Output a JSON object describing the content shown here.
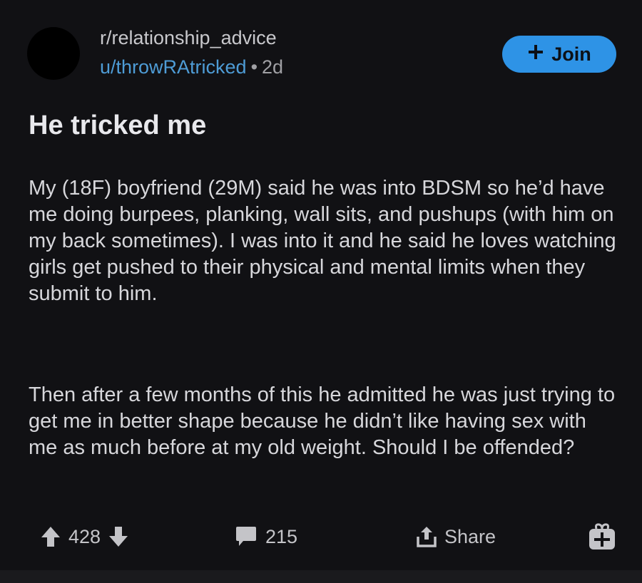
{
  "post": {
    "subreddit": "r/relationship_advice",
    "author": "u/throwRAtricked",
    "separator": "•",
    "age": "2d",
    "join_label": "Join",
    "title": "He tricked me",
    "paragraphs": [
      "My (18F) boyfriend (29M) said he was into BDSM so he’d have me doing burpees, planking, wall sits, and pushups (with him on my back sometimes). I was into it and he said he loves watching girls get pushed to their physical and mental limits when they submit to him.",
      "Then after a few months of this he admitted he was just trying to get me in better shape because he didn’t like having sex with me as much before at my old weight. Should I be offended?"
    ]
  },
  "actions": {
    "upvotes": "428",
    "comments": "215",
    "share_label": "Share"
  },
  "colors": {
    "background": "#111114",
    "accent": "#2e93e6",
    "username": "#4e9cd6",
    "text": "#d7d7db"
  },
  "icons": [
    "upvote-icon",
    "downvote-icon",
    "comment-icon",
    "share-icon",
    "award-icon",
    "plus-icon"
  ]
}
